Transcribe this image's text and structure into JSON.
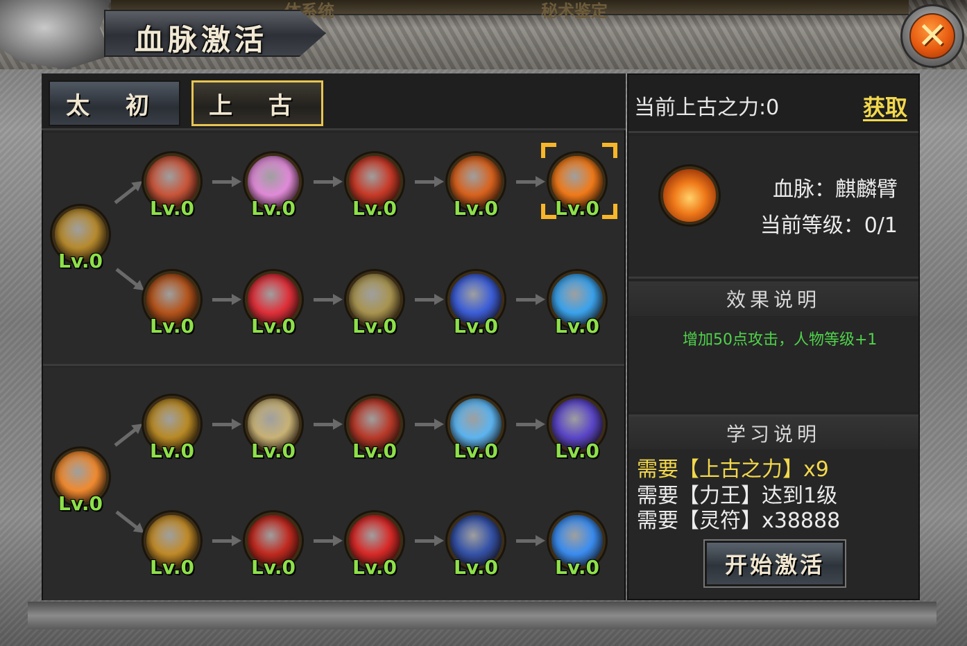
{
  "window": {
    "title": "血脉激活",
    "close_symbol": "✕",
    "background_tabs": [
      "体系统",
      "秘术鉴定"
    ]
  },
  "tabs": [
    {
      "label": "太 初",
      "active": false
    },
    {
      "label": "上 古",
      "active": true
    }
  ],
  "level_text": "Lv.0",
  "trees": [
    {
      "root": {
        "icon": "golden-warrior-icon",
        "level": "Lv.0",
        "color": "#b68a2e"
      },
      "rows": [
        [
          {
            "icon": "slash-red-icon",
            "level": "Lv.0",
            "color": "#c8553a"
          },
          {
            "icon": "pink-flower-icon",
            "level": "Lv.0",
            "color": "#e08ad8"
          },
          {
            "icon": "red-claw-icon",
            "level": "Lv.0",
            "color": "#c83a28"
          },
          {
            "icon": "flame-figure-icon",
            "level": "Lv.0",
            "color": "#d8621e"
          },
          {
            "icon": "fire-icon",
            "level": "Lv.0",
            "color": "#f07a1a",
            "selected": true
          }
        ],
        [
          {
            "icon": "muscle-figure-icon",
            "level": "Lv.0",
            "color": "#b4541c"
          },
          {
            "icon": "red-orb-icon",
            "level": "Lv.0",
            "color": "#e0303a"
          },
          {
            "icon": "sword-icon",
            "level": "Lv.0",
            "color": "#a89450"
          },
          {
            "icon": "blue-figure-icon",
            "level": "Lv.0",
            "color": "#3c5ed8"
          },
          {
            "icon": "blue-rays-icon",
            "level": "Lv.0",
            "color": "#3aa2ec"
          }
        ]
      ]
    },
    {
      "root": {
        "icon": "up-arrow-burst-icon",
        "level": "Lv.0",
        "color": "#f08a30"
      },
      "rows": [
        [
          {
            "icon": "meditating-figure-icon",
            "level": "Lv.0",
            "color": "#b88a26"
          },
          {
            "icon": "shield-icon",
            "level": "Lv.0",
            "color": "#c8b276"
          },
          {
            "icon": "chained-heart-icon",
            "level": "Lv.0",
            "color": "#b83a2a"
          },
          {
            "icon": "water-wave-icon",
            "level": "Lv.0",
            "color": "#5cb4f0"
          },
          {
            "icon": "purple-figure-icon",
            "level": "Lv.0",
            "color": "#5a46c8"
          }
        ],
        [
          {
            "icon": "sun-figure-icon",
            "level": "Lv.0",
            "color": "#c08a28"
          },
          {
            "icon": "red-strike-icon",
            "level": "Lv.0",
            "color": "#c02a20"
          },
          {
            "icon": "blood-drop-icon",
            "level": "Lv.0",
            "color": "#d82a28"
          },
          {
            "icon": "blue-crest-icon",
            "level": "Lv.0",
            "color": "#3452a8"
          },
          {
            "icon": "blue-sphere-icon",
            "level": "Lv.0",
            "color": "#3a8cf0"
          }
        ]
      ]
    }
  ],
  "right_panel": {
    "power_label": "当前上古之力:0",
    "acquire_link": "获取",
    "bloodline_label": "血脉：麒麟臂",
    "current_level_label": "当前等级：0/1",
    "effect_title": "效果说明",
    "effect_text": "增加50点攻击，人物等级+1",
    "learn_title": "学习说明",
    "requirements": [
      {
        "text": "需要【上古之力】x9",
        "highlight": true
      },
      {
        "text": "需要【力王】达到1级",
        "highlight": false
      },
      {
        "text": "需要【灵符】x38888",
        "highlight": false
      }
    ],
    "activate_button": "开始激活"
  },
  "colors": {
    "level_green": "#8ee04a",
    "effect_green": "#4fd24a",
    "gold_text": "#f2d84c",
    "selected_frame": "#f7b62a"
  }
}
